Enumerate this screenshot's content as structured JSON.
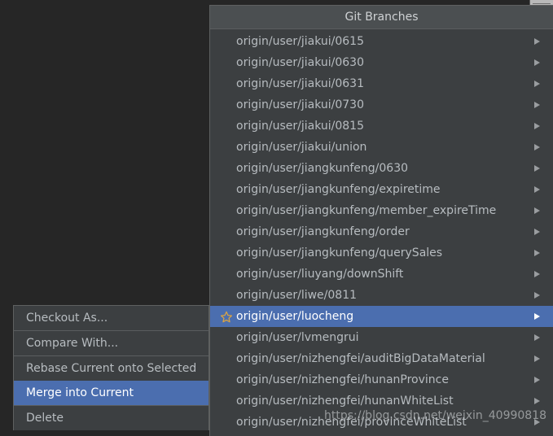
{
  "window": {
    "background_color": "#262626",
    "popup_background": "#3c3f41",
    "accent_color": "#4b6eaf",
    "text_color": "#b7bcc0",
    "star_color": "#d9a343"
  },
  "git_branches_popup": {
    "title": "Git Branches",
    "branches": [
      {
        "label": "origin/user/jiakui/0615",
        "favorite": false,
        "selected": false,
        "has_submenu": true
      },
      {
        "label": "origin/user/jiakui/0630",
        "favorite": false,
        "selected": false,
        "has_submenu": true
      },
      {
        "label": "origin/user/jiakui/0631",
        "favorite": false,
        "selected": false,
        "has_submenu": true
      },
      {
        "label": "origin/user/jiakui/0730",
        "favorite": false,
        "selected": false,
        "has_submenu": true
      },
      {
        "label": "origin/user/jiakui/0815",
        "favorite": false,
        "selected": false,
        "has_submenu": true
      },
      {
        "label": "origin/user/jiakui/union",
        "favorite": false,
        "selected": false,
        "has_submenu": true
      },
      {
        "label": "origin/user/jiangkunfeng/0630",
        "favorite": false,
        "selected": false,
        "has_submenu": true
      },
      {
        "label": "origin/user/jiangkunfeng/expiretime",
        "favorite": false,
        "selected": false,
        "has_submenu": true
      },
      {
        "label": "origin/user/jiangkunfeng/member_expireTime",
        "favorite": false,
        "selected": false,
        "has_submenu": true
      },
      {
        "label": "origin/user/jiangkunfeng/order",
        "favorite": false,
        "selected": false,
        "has_submenu": true
      },
      {
        "label": "origin/user/jiangkunfeng/querySales",
        "favorite": false,
        "selected": false,
        "has_submenu": true
      },
      {
        "label": "origin/user/liuyang/downShift",
        "favorite": false,
        "selected": false,
        "has_submenu": true
      },
      {
        "label": "origin/user/liwe/0811",
        "favorite": false,
        "selected": false,
        "has_submenu": true
      },
      {
        "label": "origin/user/luocheng",
        "favorite": true,
        "selected": true,
        "has_submenu": true
      },
      {
        "label": "origin/user/lvmengrui",
        "favorite": false,
        "selected": false,
        "has_submenu": true
      },
      {
        "label": "origin/user/nizhengfei/auditBigDataMaterial",
        "favorite": false,
        "selected": false,
        "has_submenu": true
      },
      {
        "label": "origin/user/nizhengfei/hunanProvince",
        "favorite": false,
        "selected": false,
        "has_submenu": true
      },
      {
        "label": "origin/user/nizhengfei/hunanWhiteList",
        "favorite": false,
        "selected": false,
        "has_submenu": true
      },
      {
        "label": "origin/user/nizhengfei/provinceWhiteList",
        "favorite": false,
        "selected": false,
        "has_submenu": true
      }
    ]
  },
  "context_menu": {
    "items": [
      {
        "label": "Checkout As...",
        "selected": false,
        "separator_after": true
      },
      {
        "label": "Compare With...",
        "selected": false,
        "separator_after": true
      },
      {
        "label": "Rebase Current onto Selected",
        "selected": false,
        "separator_after": false
      },
      {
        "label": "Merge into Current",
        "selected": true,
        "separator_after": true
      },
      {
        "label": "Delete",
        "selected": false,
        "separator_after": false
      }
    ]
  },
  "watermark": {
    "text": "https://blog.csdn.net/weixin_40990818"
  }
}
